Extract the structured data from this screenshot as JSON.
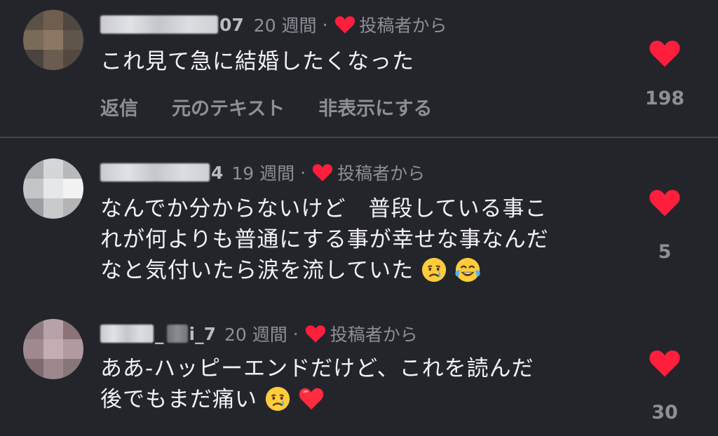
{
  "colors": {
    "background": "#24252b",
    "heart": "#ff1e3c",
    "muted_text": "#8d8f96",
    "body_text": "#f2f2f4"
  },
  "labels": {
    "creator_liked": "投稿者から"
  },
  "comments": [
    {
      "username_visible": "07",
      "age": "20 週間",
      "text": "これ見て急に結婚したくなった",
      "actions": {
        "reply": "返信",
        "original_text": "元のテキスト",
        "hide": "非表示にする"
      },
      "likes": "198",
      "like_icon": "heart-icon"
    },
    {
      "username_visible": "4",
      "age": "19 週間",
      "text_lines": [
        "なんでか分からないけど　普段している事こ",
        "れが何よりも普通にする事が幸せな事なんだ",
        "なと気付いたら涙を流していた"
      ],
      "emojis": [
        "crying-face-emoji",
        "tears-of-joy-emoji"
      ],
      "likes": "5",
      "like_icon": "heart-icon"
    },
    {
      "username_visible_prefix": "_",
      "username_visible": "i_7",
      "age": "20 週間",
      "text_lines": [
        "ああ-ハッピーエンドだけど、これを読んだ",
        "後でもまだ痛い"
      ],
      "emojis": [
        "crying-face-emoji",
        "red-heart-emoji"
      ],
      "likes": "30",
      "like_icon": "heart-icon"
    }
  ]
}
